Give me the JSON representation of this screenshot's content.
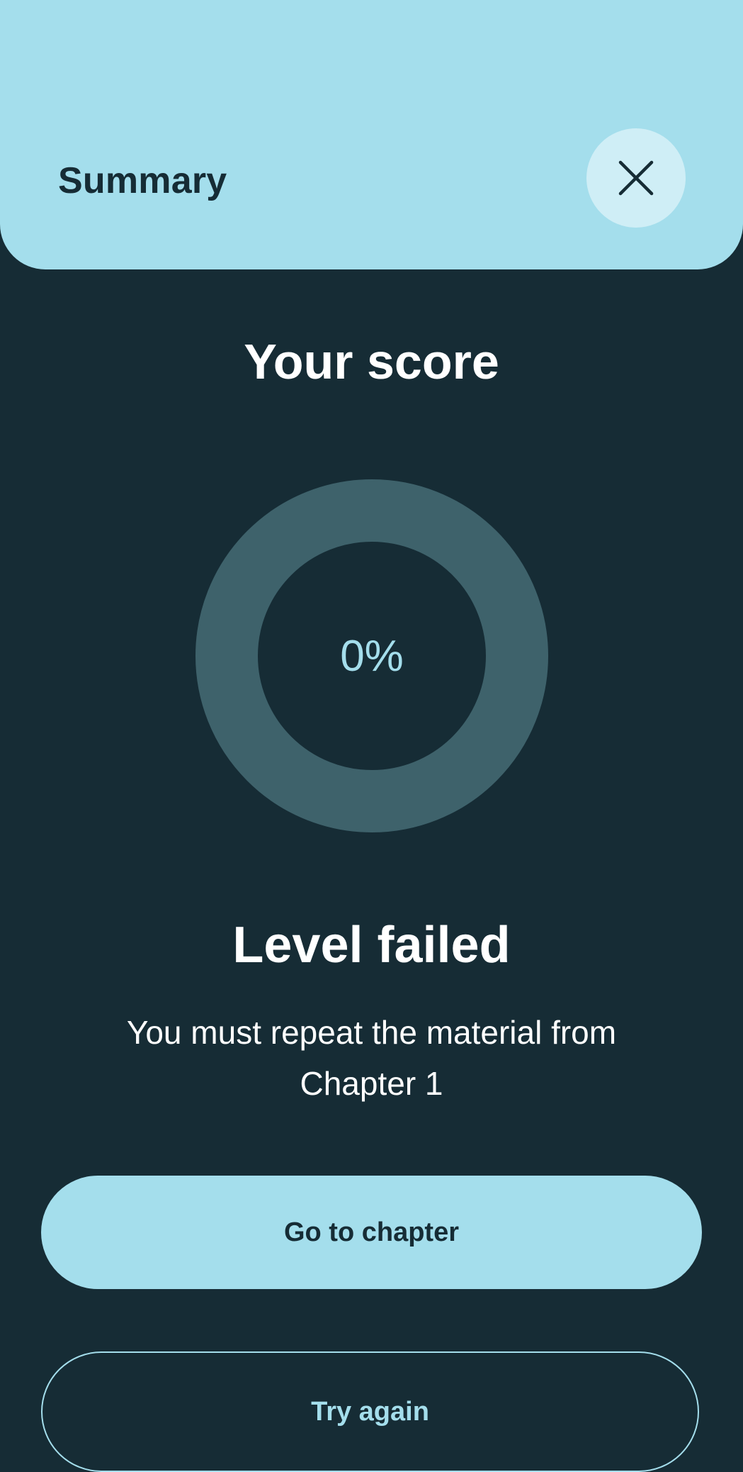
{
  "header": {
    "title": "Summary",
    "close_icon": "close-icon",
    "background_color": "#a4deec"
  },
  "score": {
    "title": "Your score",
    "value_label": "0%",
    "fraction": 0,
    "ring_color": "#3e626b",
    "progress_color": "#a4deec"
  },
  "result": {
    "title": "Level failed",
    "message": "You must repeat the material from Chapter 1"
  },
  "actions": {
    "primary_label": "Go to chapter",
    "secondary_label": "Try again"
  },
  "colors": {
    "background": "#162c35",
    "accent": "#a4deec"
  }
}
